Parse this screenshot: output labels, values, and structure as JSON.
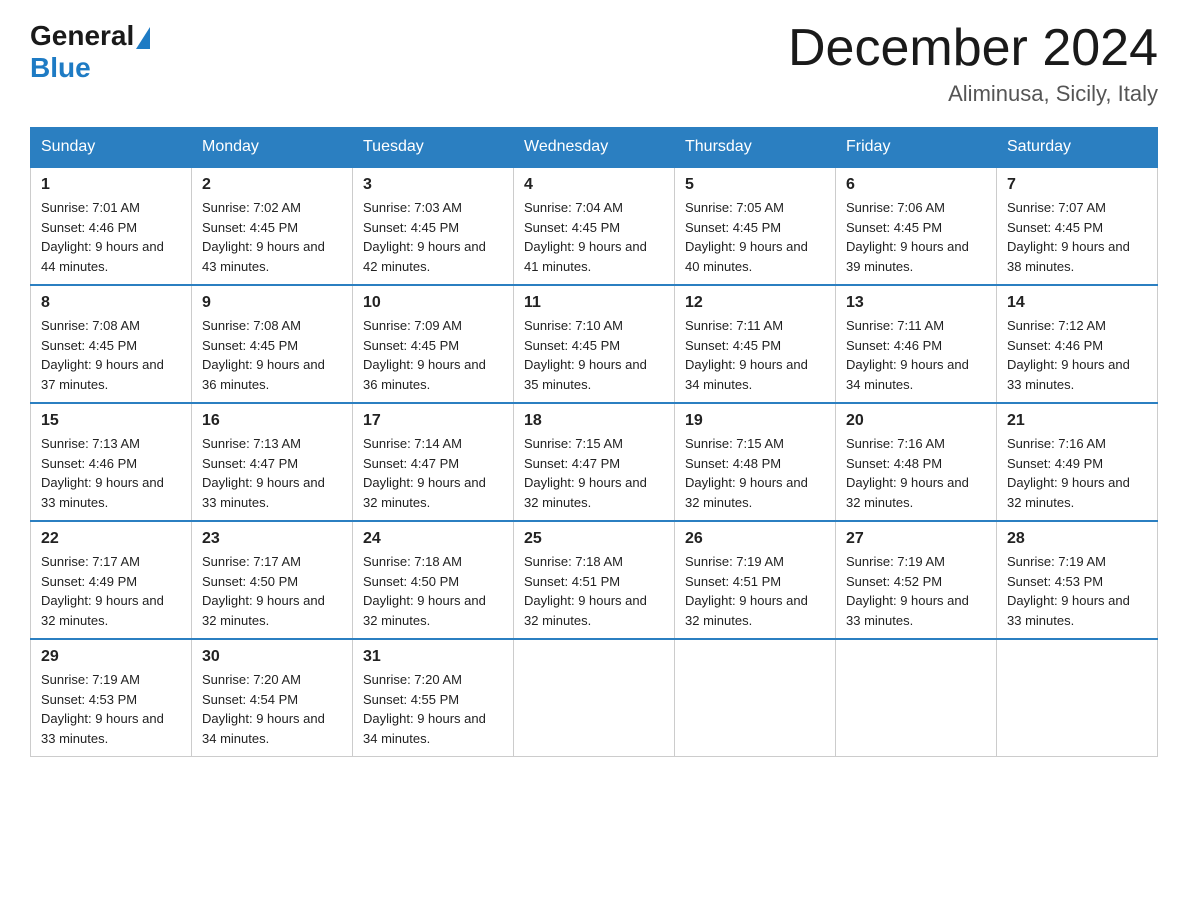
{
  "header": {
    "logo_general": "General",
    "logo_blue": "Blue",
    "month_title": "December 2024",
    "location": "Aliminusa, Sicily, Italy"
  },
  "weekdays": [
    "Sunday",
    "Monday",
    "Tuesday",
    "Wednesday",
    "Thursday",
    "Friday",
    "Saturday"
  ],
  "weeks": [
    [
      {
        "day": "1",
        "sunrise": "7:01 AM",
        "sunset": "4:46 PM",
        "daylight": "9 hours and 44 minutes."
      },
      {
        "day": "2",
        "sunrise": "7:02 AM",
        "sunset": "4:45 PM",
        "daylight": "9 hours and 43 minutes."
      },
      {
        "day": "3",
        "sunrise": "7:03 AM",
        "sunset": "4:45 PM",
        "daylight": "9 hours and 42 minutes."
      },
      {
        "day": "4",
        "sunrise": "7:04 AM",
        "sunset": "4:45 PM",
        "daylight": "9 hours and 41 minutes."
      },
      {
        "day": "5",
        "sunrise": "7:05 AM",
        "sunset": "4:45 PM",
        "daylight": "9 hours and 40 minutes."
      },
      {
        "day": "6",
        "sunrise": "7:06 AM",
        "sunset": "4:45 PM",
        "daylight": "9 hours and 39 minutes."
      },
      {
        "day": "7",
        "sunrise": "7:07 AM",
        "sunset": "4:45 PM",
        "daylight": "9 hours and 38 minutes."
      }
    ],
    [
      {
        "day": "8",
        "sunrise": "7:08 AM",
        "sunset": "4:45 PM",
        "daylight": "9 hours and 37 minutes."
      },
      {
        "day": "9",
        "sunrise": "7:08 AM",
        "sunset": "4:45 PM",
        "daylight": "9 hours and 36 minutes."
      },
      {
        "day": "10",
        "sunrise": "7:09 AM",
        "sunset": "4:45 PM",
        "daylight": "9 hours and 36 minutes."
      },
      {
        "day": "11",
        "sunrise": "7:10 AM",
        "sunset": "4:45 PM",
        "daylight": "9 hours and 35 minutes."
      },
      {
        "day": "12",
        "sunrise": "7:11 AM",
        "sunset": "4:45 PM",
        "daylight": "9 hours and 34 minutes."
      },
      {
        "day": "13",
        "sunrise": "7:11 AM",
        "sunset": "4:46 PM",
        "daylight": "9 hours and 34 minutes."
      },
      {
        "day": "14",
        "sunrise": "7:12 AM",
        "sunset": "4:46 PM",
        "daylight": "9 hours and 33 minutes."
      }
    ],
    [
      {
        "day": "15",
        "sunrise": "7:13 AM",
        "sunset": "4:46 PM",
        "daylight": "9 hours and 33 minutes."
      },
      {
        "day": "16",
        "sunrise": "7:13 AM",
        "sunset": "4:47 PM",
        "daylight": "9 hours and 33 minutes."
      },
      {
        "day": "17",
        "sunrise": "7:14 AM",
        "sunset": "4:47 PM",
        "daylight": "9 hours and 32 minutes."
      },
      {
        "day": "18",
        "sunrise": "7:15 AM",
        "sunset": "4:47 PM",
        "daylight": "9 hours and 32 minutes."
      },
      {
        "day": "19",
        "sunrise": "7:15 AM",
        "sunset": "4:48 PM",
        "daylight": "9 hours and 32 minutes."
      },
      {
        "day": "20",
        "sunrise": "7:16 AM",
        "sunset": "4:48 PM",
        "daylight": "9 hours and 32 minutes."
      },
      {
        "day": "21",
        "sunrise": "7:16 AM",
        "sunset": "4:49 PM",
        "daylight": "9 hours and 32 minutes."
      }
    ],
    [
      {
        "day": "22",
        "sunrise": "7:17 AM",
        "sunset": "4:49 PM",
        "daylight": "9 hours and 32 minutes."
      },
      {
        "day": "23",
        "sunrise": "7:17 AM",
        "sunset": "4:50 PM",
        "daylight": "9 hours and 32 minutes."
      },
      {
        "day": "24",
        "sunrise": "7:18 AM",
        "sunset": "4:50 PM",
        "daylight": "9 hours and 32 minutes."
      },
      {
        "day": "25",
        "sunrise": "7:18 AM",
        "sunset": "4:51 PM",
        "daylight": "9 hours and 32 minutes."
      },
      {
        "day": "26",
        "sunrise": "7:19 AM",
        "sunset": "4:51 PM",
        "daylight": "9 hours and 32 minutes."
      },
      {
        "day": "27",
        "sunrise": "7:19 AM",
        "sunset": "4:52 PM",
        "daylight": "9 hours and 33 minutes."
      },
      {
        "day": "28",
        "sunrise": "7:19 AM",
        "sunset": "4:53 PM",
        "daylight": "9 hours and 33 minutes."
      }
    ],
    [
      {
        "day": "29",
        "sunrise": "7:19 AM",
        "sunset": "4:53 PM",
        "daylight": "9 hours and 33 minutes."
      },
      {
        "day": "30",
        "sunrise": "7:20 AM",
        "sunset": "4:54 PM",
        "daylight": "9 hours and 34 minutes."
      },
      {
        "day": "31",
        "sunrise": "7:20 AM",
        "sunset": "4:55 PM",
        "daylight": "9 hours and 34 minutes."
      },
      null,
      null,
      null,
      null
    ]
  ]
}
